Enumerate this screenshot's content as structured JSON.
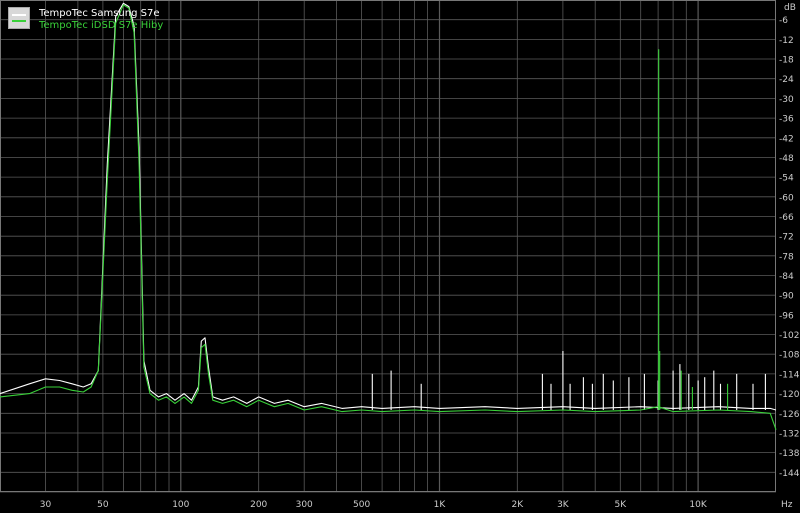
{
  "chart_data": {
    "type": "line",
    "xscale": "log",
    "xlim": [
      20,
      20000
    ],
    "ylim": [
      -150,
      0
    ],
    "xunit": "Hz",
    "yunit": "dB",
    "xticks": [
      {
        "value": 30,
        "label": "30"
      },
      {
        "value": 50,
        "label": "50"
      },
      {
        "value": 100,
        "label": "100"
      },
      {
        "value": 200,
        "label": "200"
      },
      {
        "value": 300,
        "label": "300"
      },
      {
        "value": 500,
        "label": "500"
      },
      {
        "value": 1000,
        "label": "1K"
      },
      {
        "value": 2000,
        "label": "2K"
      },
      {
        "value": 3000,
        "label": "3K"
      },
      {
        "value": 5000,
        "label": "5K"
      },
      {
        "value": 10000,
        "label": "10K"
      }
    ],
    "yticks": [
      -6,
      -12,
      -18,
      -24,
      -30,
      -36,
      -42,
      -48,
      -54,
      -60,
      -66,
      -72,
      -78,
      -84,
      -90,
      -96,
      -102,
      -108,
      -114,
      -120,
      -126,
      -132,
      -138,
      -144
    ],
    "grid": true,
    "legend_position": "top-left",
    "background": "#000000",
    "grid_color": "#5a5a5a",
    "series": [
      {
        "name": "TempoTec Samsung S7e",
        "color": "#ffffff",
        "points": [
          [
            20,
            -120
          ],
          [
            26,
            -117
          ],
          [
            30,
            -115.5
          ],
          [
            34,
            -116
          ],
          [
            38,
            -117
          ],
          [
            42,
            -118
          ],
          [
            45,
            -117
          ],
          [
            48,
            -113
          ],
          [
            52,
            -50
          ],
          [
            56,
            -5
          ],
          [
            60,
            -1
          ],
          [
            63,
            -2
          ],
          [
            66,
            -8
          ],
          [
            69,
            -45
          ],
          [
            72,
            -110
          ],
          [
            76,
            -119
          ],
          [
            82,
            -121
          ],
          [
            88,
            -120
          ],
          [
            95,
            -122
          ],
          [
            103,
            -120
          ],
          [
            110,
            -122
          ],
          [
            117,
            -118
          ],
          [
            120,
            -104
          ],
          [
            124,
            -103
          ],
          [
            128,
            -112
          ],
          [
            133,
            -121
          ],
          [
            145,
            -122
          ],
          [
            160,
            -121
          ],
          [
            180,
            -123
          ],
          [
            200,
            -121
          ],
          [
            230,
            -123
          ],
          [
            260,
            -122
          ],
          [
            300,
            -124
          ],
          [
            350,
            -123
          ],
          [
            420,
            -124.5
          ],
          [
            500,
            -124
          ],
          [
            600,
            -124.5
          ],
          [
            800,
            -124
          ],
          [
            1000,
            -124.5
          ],
          [
            1500,
            -124
          ],
          [
            2000,
            -124.5
          ],
          [
            3000,
            -124
          ],
          [
            4000,
            -124.5
          ],
          [
            6000,
            -124
          ],
          [
            8000,
            -124.5
          ],
          [
            12000,
            -124
          ],
          [
            16000,
            -124.5
          ],
          [
            19000,
            -124.5
          ],
          [
            20000,
            -125
          ]
        ],
        "spikes": [
          [
            550,
            -114
          ],
          [
            650,
            -113
          ],
          [
            850,
            -117
          ],
          [
            2500,
            -114
          ],
          [
            2700,
            -117
          ],
          [
            3000,
            -107
          ],
          [
            3200,
            -117
          ],
          [
            3600,
            -115
          ],
          [
            3900,
            -117
          ],
          [
            4300,
            -114
          ],
          [
            4700,
            -116
          ],
          [
            5400,
            -115
          ],
          [
            6200,
            -114
          ],
          [
            7000,
            -116
          ],
          [
            8000,
            -113
          ],
          [
            8500,
            -111
          ],
          [
            9200,
            -114
          ],
          [
            10000,
            -116
          ],
          [
            10600,
            -115
          ],
          [
            11500,
            -113
          ],
          [
            12200,
            -117
          ],
          [
            14100,
            -114
          ],
          [
            16300,
            -117
          ],
          [
            18200,
            -114
          ]
        ]
      },
      {
        "name": "TempoTec iDSD S7e Hiby",
        "color": "#39d039",
        "points": [
          [
            20,
            -121
          ],
          [
            26,
            -120
          ],
          [
            30,
            -118
          ],
          [
            34,
            -118
          ],
          [
            38,
            -119
          ],
          [
            42,
            -119.5
          ],
          [
            45,
            -118
          ],
          [
            48,
            -113
          ],
          [
            52,
            -55
          ],
          [
            56,
            -7
          ],
          [
            60,
            -1.5
          ],
          [
            63,
            -2.5
          ],
          [
            66,
            -10
          ],
          [
            69,
            -50
          ],
          [
            72,
            -112
          ],
          [
            76,
            -120
          ],
          [
            82,
            -122
          ],
          [
            88,
            -121
          ],
          [
            95,
            -123
          ],
          [
            103,
            -121
          ],
          [
            110,
            -123
          ],
          [
            117,
            -119
          ],
          [
            120,
            -106
          ],
          [
            124,
            -105
          ],
          [
            128,
            -114
          ],
          [
            133,
            -122
          ],
          [
            145,
            -123
          ],
          [
            160,
            -122
          ],
          [
            180,
            -124
          ],
          [
            200,
            -122
          ],
          [
            230,
            -124
          ],
          [
            260,
            -123
          ],
          [
            300,
            -125
          ],
          [
            350,
            -124
          ],
          [
            420,
            -125.5
          ],
          [
            500,
            -125
          ],
          [
            600,
            -125.5
          ],
          [
            800,
            -125
          ],
          [
            1000,
            -125.5
          ],
          [
            1500,
            -125
          ],
          [
            2000,
            -125.5
          ],
          [
            3000,
            -125
          ],
          [
            4000,
            -125.5
          ],
          [
            6000,
            -125
          ],
          [
            7000,
            -124
          ],
          [
            8000,
            -125.5
          ],
          [
            12000,
            -125
          ],
          [
            16000,
            -125.5
          ],
          [
            19000,
            -126
          ],
          [
            20000,
            -131
          ]
        ],
        "spikes": [
          [
            7040,
            -15
          ],
          [
            7100,
            -107
          ],
          [
            8600,
            -113
          ],
          [
            9500,
            -118
          ],
          [
            13000,
            -117
          ]
        ]
      }
    ]
  }
}
